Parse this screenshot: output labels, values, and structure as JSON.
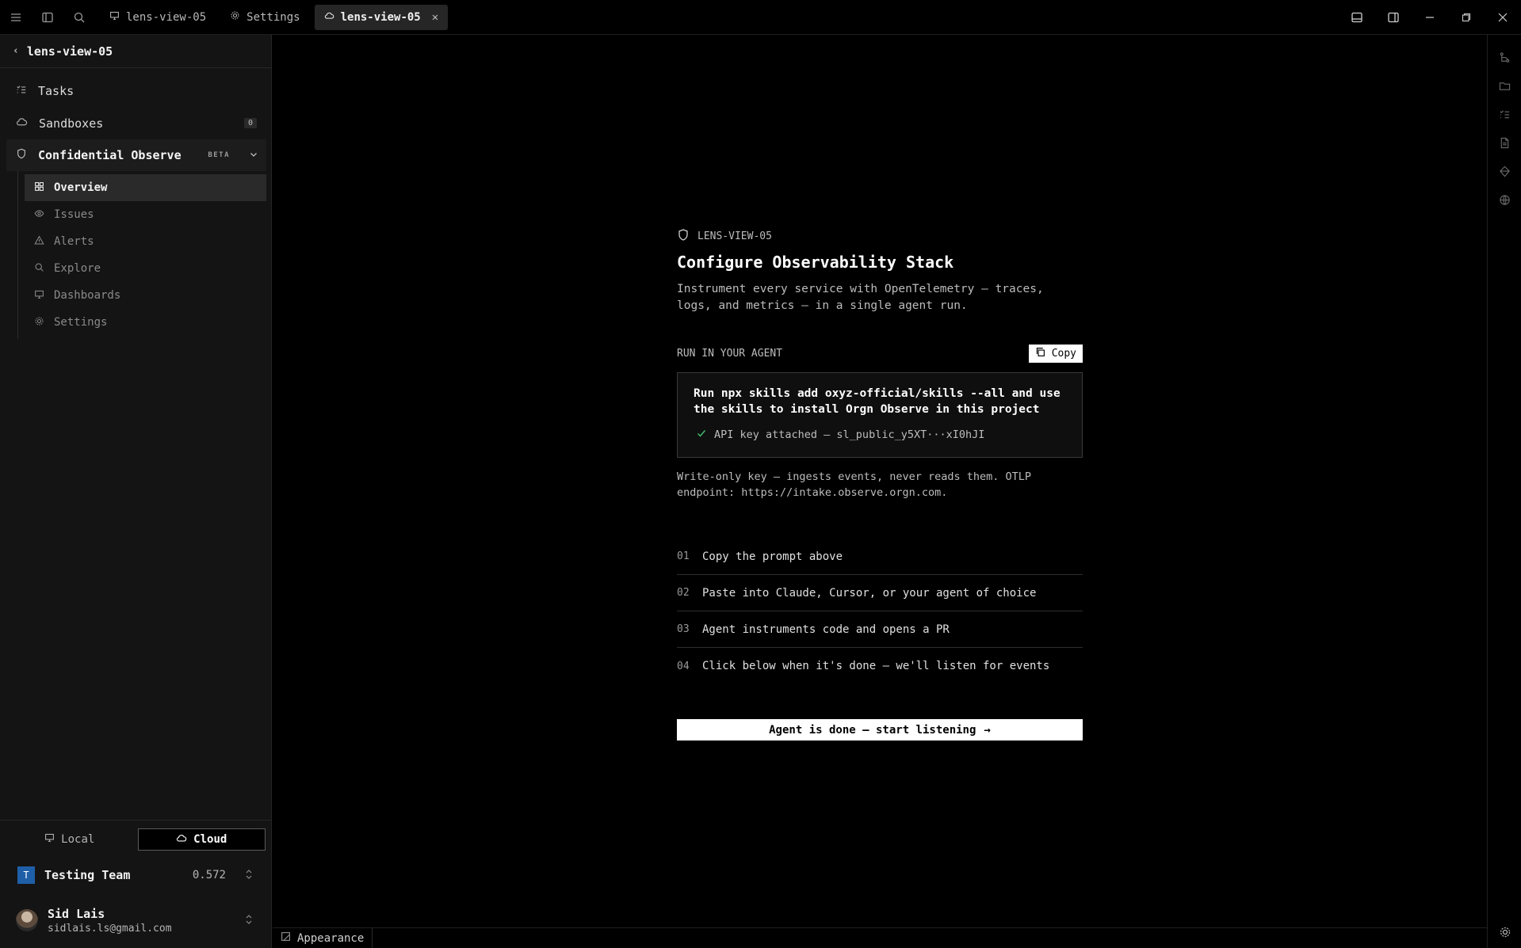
{
  "titlebar": {
    "tabs": [
      {
        "label": "lens-view-05",
        "icon": "monitor-icon",
        "active": false
      },
      {
        "label": "Settings",
        "icon": "gear-icon",
        "active": false
      },
      {
        "label": "lens-view-05",
        "icon": "cloud-icon",
        "active": true
      }
    ]
  },
  "sidebar": {
    "back_title": "lens-view-05",
    "items": [
      {
        "label": "Tasks",
        "icon": "tasks-icon"
      },
      {
        "label": "Sandboxes",
        "icon": "cloud-icon",
        "badge": "0"
      }
    ],
    "group": {
      "label": "Confidential Observe",
      "tag": "BETA",
      "items": [
        {
          "label": "Overview",
          "icon": "grid-icon",
          "active": true
        },
        {
          "label": "Issues",
          "icon": "eye-icon"
        },
        {
          "label": "Alerts",
          "icon": "warning-icon"
        },
        {
          "label": "Explore",
          "icon": "search-icon"
        },
        {
          "label": "Dashboards",
          "icon": "monitor-icon"
        },
        {
          "label": "Settings",
          "icon": "gear-icon"
        }
      ]
    },
    "mode_toggle": {
      "local": "Local",
      "cloud": "Cloud",
      "selected": "Cloud"
    },
    "team": {
      "initial": "T",
      "name": "Testing Team",
      "value": "0.572"
    },
    "user": {
      "name": "Sid Lais",
      "email": "sidlais.ls@gmail.com"
    }
  },
  "main": {
    "eyebrow": "LENS-VIEW-05",
    "title": "Configure Observability Stack",
    "description": "Instrument every service with OpenTelemetry — traces, logs, and metrics — in a single agent run.",
    "run_label": "RUN IN YOUR AGENT",
    "copy_label": "Copy",
    "prompt": "Run npx skills add oxyz-official/skills --all and use the skills to install Orgn Observe in this project",
    "api_key_line": "API key attached — sl_public_y5XT···xI0hJI",
    "note": "Write-only key — ingests events, never reads them. OTLP endpoint: https://intake.observe.orgn.com.",
    "steps": [
      {
        "num": "01",
        "text": "Copy the prompt above"
      },
      {
        "num": "02",
        "text": "Paste into Claude, Cursor, or your agent of choice"
      },
      {
        "num": "03",
        "text": "Agent instruments code and opens a PR"
      },
      {
        "num": "04",
        "text": "Click below when it's done — we'll listen for events"
      }
    ],
    "cta_label": "Agent is done — start listening",
    "cta_arrow": "→"
  },
  "statusbar": {
    "appearance_label": "Appearance"
  }
}
